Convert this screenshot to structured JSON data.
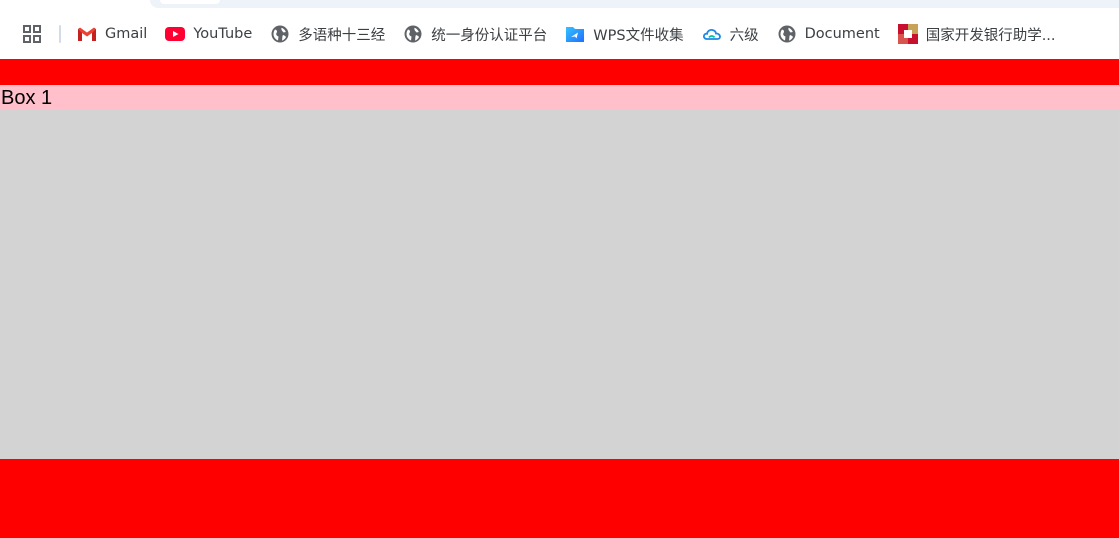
{
  "bookmarks_bar": {
    "apps_icon": "apps-grid-icon",
    "items": [
      {
        "label": "Gmail",
        "icon": "gmail-icon"
      },
      {
        "label": "YouTube",
        "icon": "youtube-icon"
      },
      {
        "label": "多语种十三经",
        "icon": "globe-icon"
      },
      {
        "label": "统一身份认证平台",
        "icon": "globe-icon"
      },
      {
        "label": "WPS文件收集",
        "icon": "wps-icon"
      },
      {
        "label": "六级",
        "icon": "cloud-icon"
      },
      {
        "label": "Document",
        "icon": "globe-icon"
      },
      {
        "label": "国家开发银行助学...",
        "icon": "bank-logo-icon"
      }
    ]
  },
  "page": {
    "box1_label": "Box 1"
  },
  "colors": {
    "band": "#ff0000",
    "box1_background": "#ffc0cb",
    "content_background": "#d3d3d3",
    "gmail_red": "#ea4335",
    "youtube_red": "#ff0033",
    "globe_grey": "#5f6368",
    "wps_blue": "#2f8cff"
  }
}
